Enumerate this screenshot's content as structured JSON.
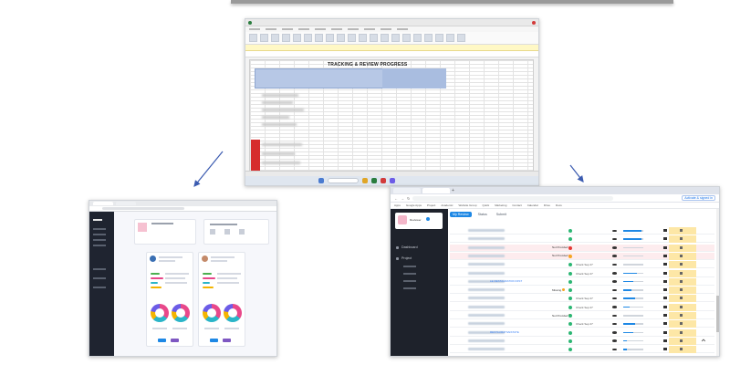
{
  "spreadsheet": {
    "title": "TRACKING & REVIEW PROGRESS"
  },
  "project_list": {
    "browser_profile_label": "Activate & signed in",
    "bookmarks": [
      "Apps",
      "Google Apps",
      "Project",
      "Academic",
      "Website Group",
      "Quick",
      "Marketing",
      "Contact",
      "Calendar",
      "Drive",
      "Docs"
    ],
    "sidebar": {
      "role": "Reviewer",
      "items": [
        "Dashboard",
        "Project"
      ]
    },
    "tabs": [
      "My Review",
      "Status",
      "Submit"
    ],
    "rows": [
      {
        "num": "",
        "link": "",
        "status": "",
        "date": "",
        "dot": "#2bb673",
        "progress": 0.9,
        "pink": false
      },
      {
        "num": "",
        "link": "",
        "status": "",
        "date": "",
        "dot": "#2bb673",
        "progress": 0.9,
        "pink": false
      },
      {
        "num": "",
        "link": "",
        "status": "Not Provided",
        "date": "",
        "dot": "#e53935",
        "progress": 0.0,
        "pink": true
      },
      {
        "num": "",
        "link": "",
        "status": "Not Provided",
        "date": "",
        "dot": "#f6a623",
        "progress": 0.0,
        "pink": true
      },
      {
        "num": "",
        "link": "",
        "status": "",
        "date": "Check Sep 27",
        "dot": "#2bb673",
        "progress": 0.0,
        "pink": false
      },
      {
        "num": "",
        "link": "",
        "status": "",
        "date": "Check Sep 27",
        "dot": "#2bb673",
        "progress": 0.7,
        "pink": false
      },
      {
        "num": "",
        "link": "LE RESTAURATION DIST",
        "status": "",
        "date": "",
        "dot": "#2bb673",
        "progress": 0.5,
        "pink": false
      },
      {
        "num": "",
        "link": "",
        "status": "Missing",
        "date": "",
        "dot": "#2bb673",
        "progress": 0.4,
        "pink": false
      },
      {
        "num": "",
        "link": "",
        "status": "",
        "date": "Check Sep 27",
        "dot": "#2bb673",
        "progress": 0.6,
        "pink": false
      },
      {
        "num": "",
        "link": "",
        "status": "",
        "date": "Check Sep 27",
        "dot": "#2bb673",
        "progress": 0.3,
        "pink": false
      },
      {
        "num": "",
        "link": "",
        "status": "Not Provided",
        "date": "",
        "dot": "#2bb673",
        "progress": 0.0,
        "pink": false
      },
      {
        "num": "",
        "link": "",
        "status": "",
        "date": "Check Sep 27",
        "dot": "#2bb673",
        "progress": 0.6,
        "pink": false
      },
      {
        "num": "",
        "link": "RESTAURATIVESTATE",
        "status": "",
        "date": "",
        "dot": "#2bb673",
        "progress": 0.5,
        "pink": false
      },
      {
        "num": "",
        "link": "",
        "status": "",
        "date": "",
        "dot": "#2bb673",
        "progress": 0.2,
        "pink": false
      },
      {
        "num": "",
        "link": "",
        "status": "",
        "date": "",
        "dot": "#2bb673",
        "progress": 0.2,
        "pink": false
      }
    ],
    "scroll_top_icon": "chevron-up-icon"
  },
  "colors": {
    "accent": "#1e88e5",
    "sidebar_dark": "#1e222b",
    "highlight_yellow": "#fde7a6",
    "warn_red": "#d62c2c"
  }
}
